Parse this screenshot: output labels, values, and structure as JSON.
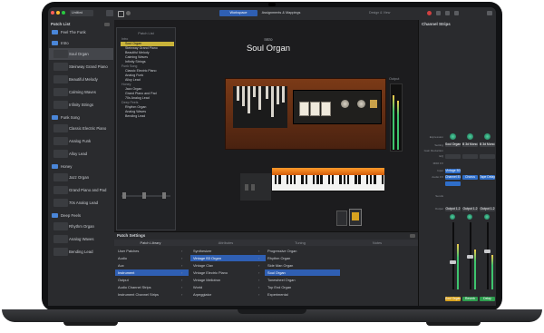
{
  "toolbar": {
    "left_field": "Untitled",
    "tabs": [
      "Workspace",
      "Assignments & Mappings"
    ],
    "active_tab": "Workspace",
    "right_label": "Design & View"
  },
  "patch_list": {
    "title": "Patch List",
    "groups": [
      {
        "name": "Feel The Funk",
        "items": []
      },
      {
        "name": "Intro",
        "items": [
          "Soul Organ",
          "Steinway Grand Piano",
          "Beautiful Melody",
          "Calming Waves",
          "Infinity Strings"
        ]
      },
      {
        "name": "Funk Song",
        "items": [
          "Classic Electric Piano",
          "Analog Funk",
          "Alloy Lead"
        ]
      },
      {
        "name": "Honey",
        "items": [
          "Jazz Organ",
          "Grand Piano and Pad",
          "70s Analog Lead"
        ]
      },
      {
        "name": "Deep Feels",
        "items": [
          "Rhythm Organ",
          "Analog Waves",
          "Bending Lead"
        ]
      }
    ],
    "selected": "Soul Organ"
  },
  "mini_list": {
    "title": "Patch List",
    "items": [
      "Intro",
      "Soul Organ",
      "Steinway Grand Piano",
      "Beautiful Melody",
      "Calming Waves",
      "Infinity Strings",
      "Funk Song",
      "Classic Electric Piano",
      "Analog Funk",
      "Alloy Lead",
      "Honey",
      "Jazz Organ",
      "Grand Piano and Pad",
      "70s Analog Lead",
      "Deep Feels",
      "Rhythm Organ",
      "Analog Waves",
      "Bending Lead"
    ]
  },
  "workspace": {
    "section": "Intro",
    "patch_title": "Soul Organ",
    "output_label": "Output"
  },
  "channel_strips": {
    "title": "Channel Strips",
    "row_labels": [
      "Expression",
      "Setting",
      "Gain Reduction",
      "EQ",
      "MIDI FX",
      "Input",
      "Audio FX",
      "",
      "Sends",
      "",
      "Output"
    ],
    "strips": [
      {
        "setting": "Soul Organ",
        "input": "Vintage B3",
        "audio_fx": "Channel EQ",
        "output": "Output 1-2",
        "name": "Soul Organ",
        "color": "#d8a21f"
      },
      {
        "setting": "B 3d Mono1",
        "input": "",
        "audio_fx": "Chorus",
        "output": "Output 1-2",
        "name": "Reverb",
        "color": "#2e9e4f"
      },
      {
        "setting": "B 3d Mono1",
        "input": "",
        "audio_fx": "Tape Delay",
        "output": "Output 1-2",
        "name": "Delay",
        "color": "#2e9e4f"
      }
    ]
  },
  "bottom": {
    "title": "Patch Settings",
    "column_headers": [
      "Patch Library",
      "Attributes",
      "Tuning",
      "Notes"
    ],
    "library": [
      "User Patches",
      "Audio",
      "Aux",
      "Instrument",
      "Output",
      "Audio Channel Strips",
      "Instrument Channel Strips"
    ],
    "library_selected": "Instrument",
    "category": [
      "Synthesizer",
      "Vintage B3 Organ",
      "Vintage Clav",
      "Vintage Electric Piano",
      "Vintage Mellotron",
      "World",
      "Arpeggiator"
    ],
    "category_selected": "Vintage B3 Organ",
    "patches": [
      "Progressive Organ",
      "Rhythm Organ",
      "Side Man Organ",
      "Soul Organ",
      "Tonewheel Organ",
      "Top End Organ",
      "Experimental"
    ],
    "patches_selected": "Soul Organ"
  },
  "colors": {
    "accent": "#2f5fb3",
    "orange": "#e8731a"
  }
}
